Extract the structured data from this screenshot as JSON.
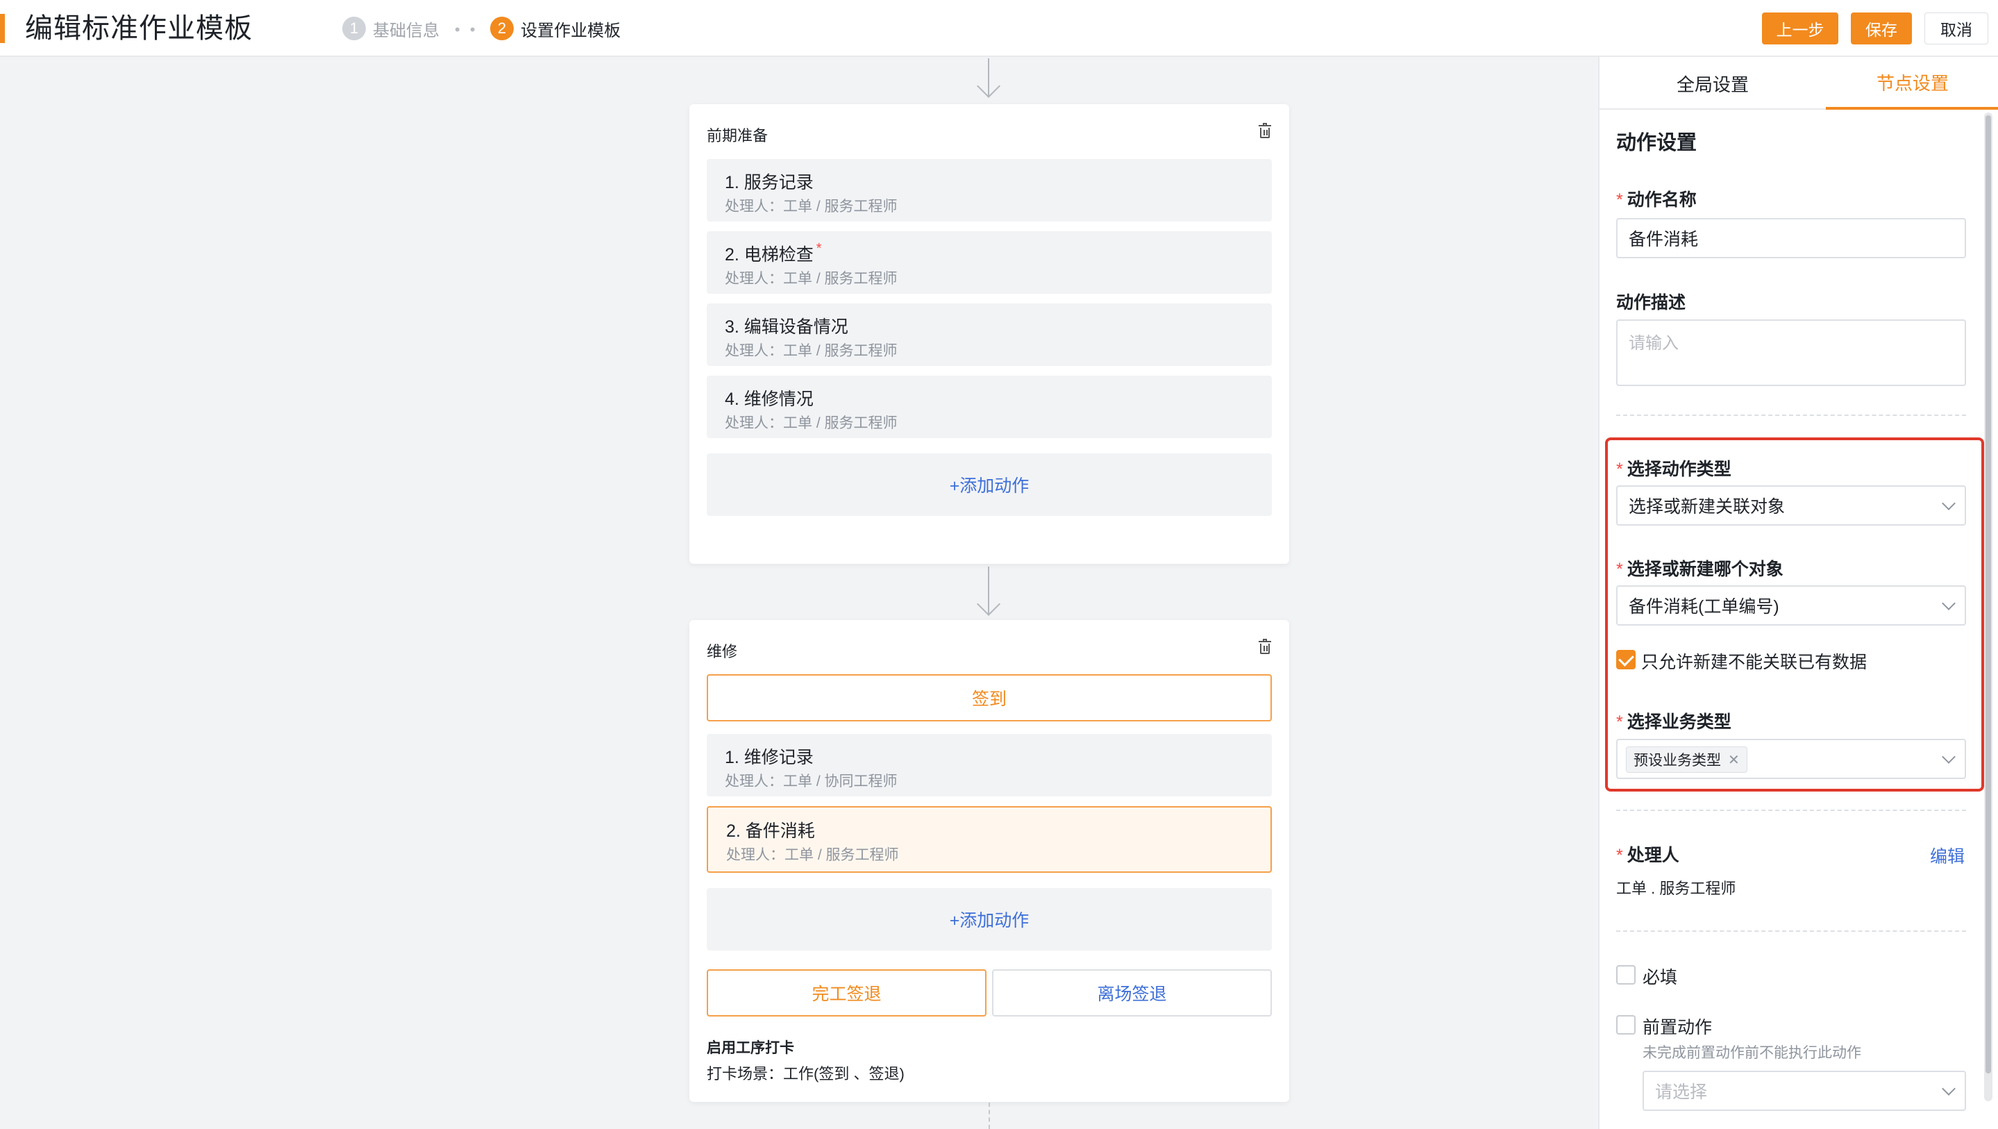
{
  "header": {
    "title": "编辑标准作业模板",
    "steps": [
      {
        "num": "1",
        "label": "基础信息"
      },
      {
        "num": "2",
        "label": "设置作业模板"
      }
    ],
    "step_separator": "• •",
    "buttons": {
      "prev": "上一步",
      "save": "保存",
      "cancel": "取消"
    },
    "accent_color": "#f28a1e"
  },
  "canvas": {
    "stage1": {
      "title": "前期准备",
      "actions": [
        {
          "name": "1. 服务记录",
          "handler": "处理人：工单 / 服务工程师",
          "required": ""
        },
        {
          "name": "2. 电梯检查",
          "handler": "处理人：工单 / 服务工程师",
          "required": "*"
        },
        {
          "name": "3. 编辑设备情况",
          "handler": "处理人：工单 / 服务工程师",
          "required": ""
        },
        {
          "name": "4. 维修情况",
          "handler": "处理人：工单 / 服务工程师",
          "required": ""
        }
      ],
      "add_action": "+添加动作"
    },
    "stage2": {
      "title": "维修",
      "checkin": "签到",
      "actions": [
        {
          "name": "1. 维修记录",
          "handler": "处理人：工单 / 协同工程师"
        },
        {
          "name": "2. 备件消耗",
          "handler": "处理人：工单 / 服务工程师"
        }
      ],
      "add_action": "+添加动作",
      "finish_checkout": "完工签退",
      "leave_checkout": "离场签退",
      "punch_title": "启用工序打卡",
      "punch_desc": "打卡场景：工作(签到 、签退)"
    }
  },
  "panel": {
    "tabs": {
      "global": "全局设置",
      "node": "节点设置"
    },
    "section_title": "动作设置",
    "action_name": {
      "label": "动作名称",
      "value": "备件消耗"
    },
    "action_desc": {
      "label": "动作描述",
      "placeholder": "请输入"
    },
    "action_type": {
      "label": "选择动作类型",
      "value": "选择或新建关联对象"
    },
    "target_object": {
      "label": "选择或新建哪个对象",
      "value": "备件消耗(工单编号)"
    },
    "only_new": {
      "label": "只允许新建不能关联已有数据",
      "checked": true
    },
    "business_type": {
      "label": "选择业务类型",
      "tag": "预设业务类型"
    },
    "handler": {
      "label": "处理人",
      "edit": "编辑",
      "value": "工单 . 服务工程师"
    },
    "required": {
      "label": "必填"
    },
    "pre_action": {
      "label": "前置动作",
      "hint": "未完成前置动作前不能执行此动作",
      "placeholder": "请选择"
    },
    "highlight_color": "#e0392b"
  }
}
